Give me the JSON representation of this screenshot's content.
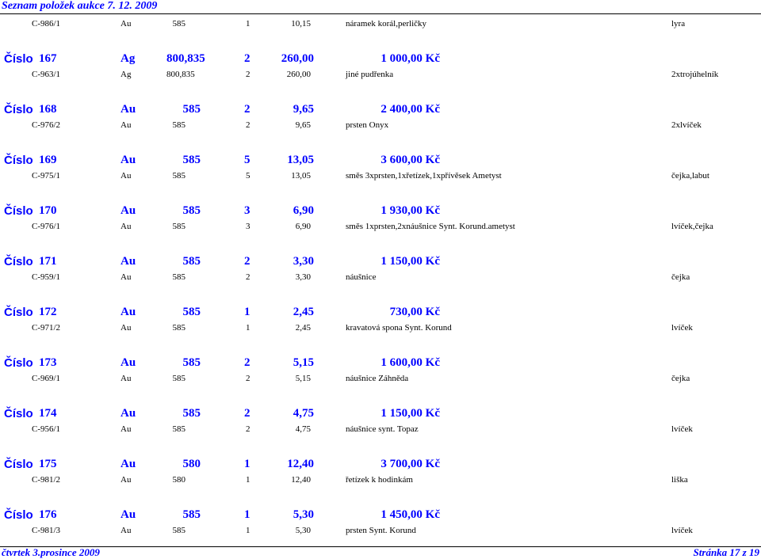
{
  "header": {
    "title": "Seznam položek aukce 7. 12. 2009"
  },
  "first_detail": {
    "code": "C-986/1",
    "metal": "Au",
    "fineness": "585",
    "qty": "1",
    "weight": "10,15",
    "description": "náramek korál,perličky",
    "mark": "lyra"
  },
  "item_label": "Číslo",
  "items": [
    {
      "num": "167",
      "metal": "Ag",
      "fineness": "800,835",
      "qty": "2",
      "weight": "260,00",
      "price": "1 000,00 Kč",
      "detail": {
        "code": "C-963/1",
        "metal": "Ag",
        "fineness": "800,835",
        "qty": "2",
        "weight": "260,00",
        "description": "jiné pudřenka",
        "mark": "2xtrojúhelník"
      }
    },
    {
      "num": "168",
      "metal": "Au",
      "fineness": "585",
      "qty": "2",
      "weight": "9,65",
      "price": "2 400,00 Kč",
      "detail": {
        "code": "C-976/2",
        "metal": "Au",
        "fineness": "585",
        "qty": "2",
        "weight": "9,65",
        "description": "prsten  Onyx",
        "mark": "2xlvíček"
      }
    },
    {
      "num": "169",
      "metal": "Au",
      "fineness": "585",
      "qty": "5",
      "weight": "13,05",
      "price": "3 600,00 Kč",
      "detail": {
        "code": "C-975/1",
        "metal": "Au",
        "fineness": "585",
        "qty": "5",
        "weight": "13,05",
        "description": "směs 3xprsten,1xřetízek,1xpřívěsek Ametyst",
        "mark": "čejka,labut"
      }
    },
    {
      "num": "170",
      "metal": "Au",
      "fineness": "585",
      "qty": "3",
      "weight": "6,90",
      "price": "1 930,00 Kč",
      "detail": {
        "code": "C-976/1",
        "metal": "Au",
        "fineness": "585",
        "qty": "3",
        "weight": "6,90",
        "description": "směs 1xprsten,2xnáušnice Synt. Korund.ametyst",
        "mark": "lvíček,čejka"
      }
    },
    {
      "num": "171",
      "metal": "Au",
      "fineness": "585",
      "qty": "2",
      "weight": "3,30",
      "price": "1 150,00 Kč",
      "detail": {
        "code": "C-959/1",
        "metal": "Au",
        "fineness": "585",
        "qty": "2",
        "weight": "3,30",
        "description": "náušnice",
        "mark": "čejka"
      }
    },
    {
      "num": "172",
      "metal": "Au",
      "fineness": "585",
      "qty": "1",
      "weight": "2,45",
      "price": "730,00 Kč",
      "detail": {
        "code": "C-971/2",
        "metal": "Au",
        "fineness": "585",
        "qty": "1",
        "weight": "2,45",
        "description": "kravatová spona  Synt. Korund",
        "mark": "lvíček"
      }
    },
    {
      "num": "173",
      "metal": "Au",
      "fineness": "585",
      "qty": "2",
      "weight": "5,15",
      "price": "1 600,00 Kč",
      "detail": {
        "code": "C-969/1",
        "metal": "Au",
        "fineness": "585",
        "qty": "2",
        "weight": "5,15",
        "description": "náušnice  Záhněda",
        "mark": "čejka"
      }
    },
    {
      "num": "174",
      "metal": "Au",
      "fineness": "585",
      "qty": "2",
      "weight": "4,75",
      "price": "1 150,00 Kč",
      "detail": {
        "code": "C-956/1",
        "metal": "Au",
        "fineness": "585",
        "qty": "2",
        "weight": "4,75",
        "description": "náušnice  synt. Topaz",
        "mark": "lvíček"
      }
    },
    {
      "num": "175",
      "metal": "Au",
      "fineness": "580",
      "qty": "1",
      "weight": "12,40",
      "price": "3 700,00 Kč",
      "detail": {
        "code": "C-981/2",
        "metal": "Au",
        "fineness": "580",
        "qty": "1",
        "weight": "12,40",
        "description": "řetízek k hodinkám",
        "mark": "liška"
      }
    },
    {
      "num": "176",
      "metal": "Au",
      "fineness": "585",
      "qty": "1",
      "weight": "5,30",
      "price": "1 450,00 Kč",
      "detail": {
        "code": "C-981/3",
        "metal": "Au",
        "fineness": "585",
        "qty": "1",
        "weight": "5,30",
        "description": "prsten  Synt. Korund",
        "mark": "lvíček"
      }
    }
  ],
  "footer": {
    "date": "čtvrtek 3.prosince 2009",
    "page": "Stránka 17 z 19"
  }
}
